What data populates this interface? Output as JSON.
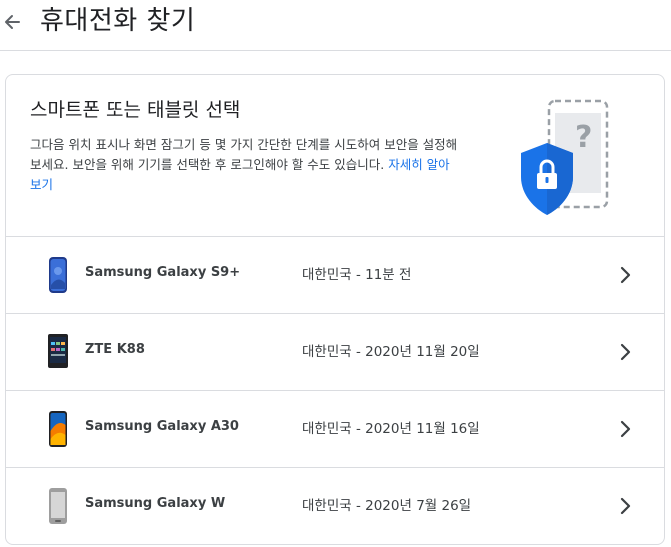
{
  "header": {
    "title": "휴대전화 찾기",
    "back_icon": "arrow-back-icon"
  },
  "intro": {
    "heading": "스마트폰 또는 태블릿 선택",
    "description": "그다음 위치 표시나 화면 잠그기 등 몇 가지 간단한 단계를 시도하여 보안을 설정해 보세요. 보안을 위해 기기를 선택한 후 로그인해야 할 수도 있습니다.",
    "learn_more": "자세히 알아보기",
    "illustration_icon": "device-security-illustration-icon"
  },
  "devices": [
    {
      "name": "Samsung Galaxy S9+",
      "detail": "대한민국 - 11분 전",
      "icon": "galaxy-s9-phone-icon"
    },
    {
      "name": "ZTE K88",
      "detail": "대한민국 - 2020년 11월 20일",
      "icon": "zte-k88-phone-icon"
    },
    {
      "name": "Samsung Galaxy A30",
      "detail": "대한민국 - 2020년 11월 16일",
      "icon": "galaxy-a30-phone-icon"
    },
    {
      "name": "Samsung Galaxy W",
      "detail": "대한민국 - 2020년 7월 26일",
      "icon": "galaxy-w-phone-icon"
    }
  ],
  "colors": {
    "link": "#1a73e8",
    "shield": "#1a73e8",
    "divider": "#dadce0",
    "text": "#202124"
  }
}
